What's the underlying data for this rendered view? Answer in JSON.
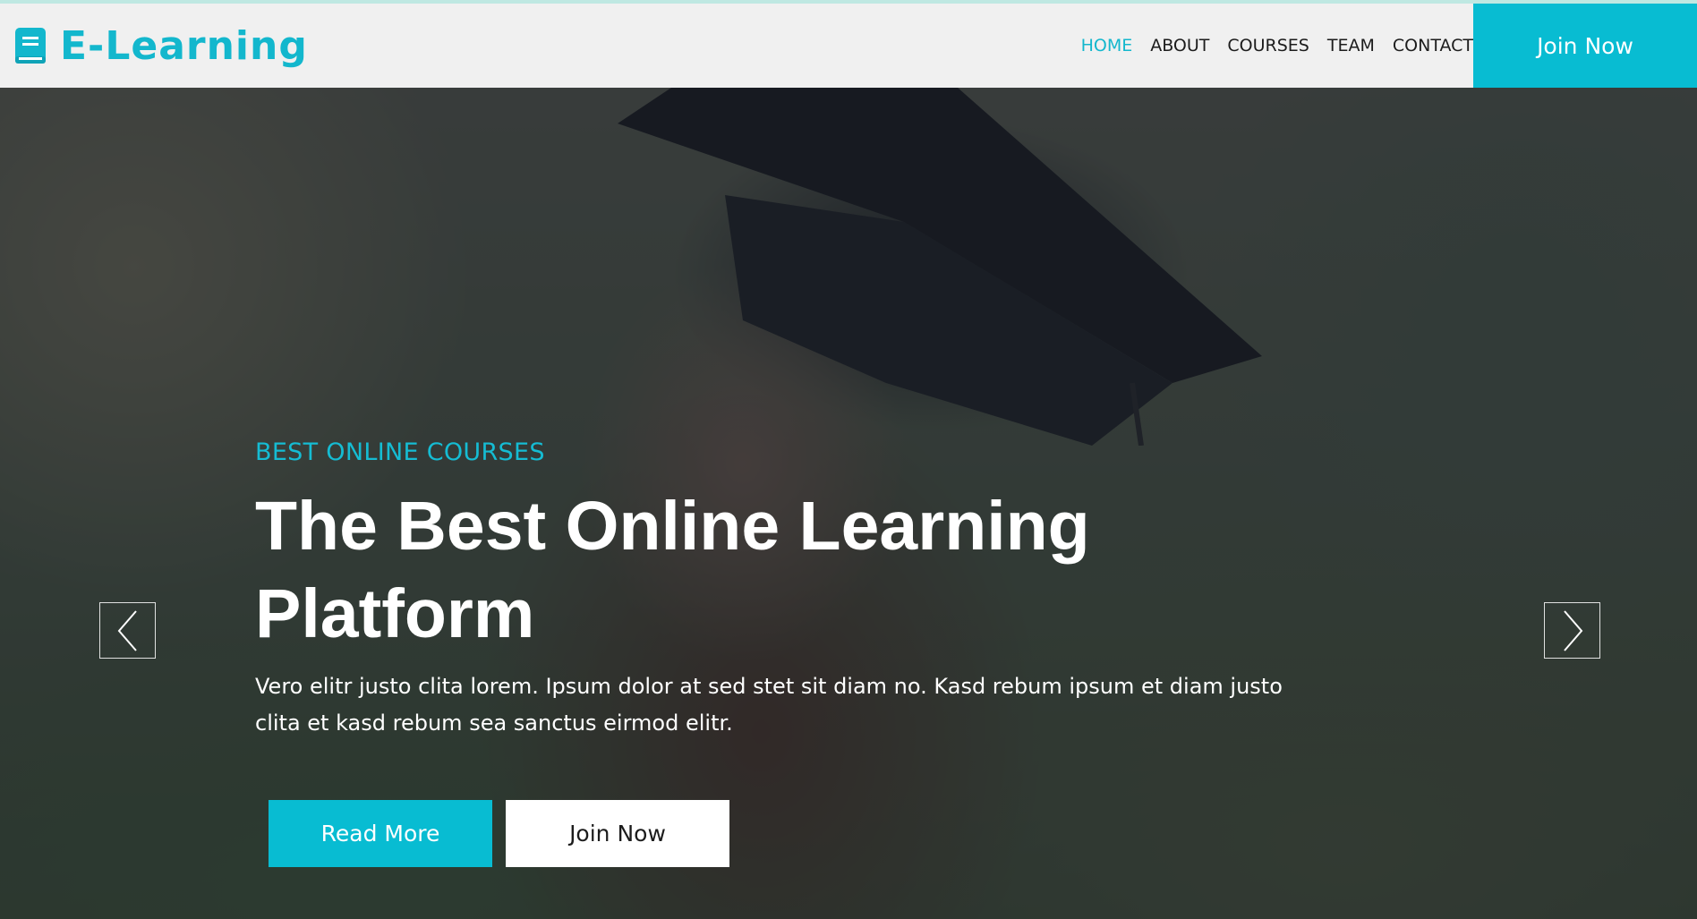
{
  "brand": {
    "name": "E-Learning",
    "icon": "book-icon",
    "accent_color": "#13b7cd"
  },
  "nav": {
    "items": [
      {
        "label": "HOME",
        "active": true
      },
      {
        "label": "ABOUT",
        "active": false
      },
      {
        "label": "COURSES",
        "active": false
      },
      {
        "label": "TEAM",
        "active": false
      },
      {
        "label": "CONTACT",
        "active": false
      }
    ],
    "cta_label": "Join Now",
    "cta_color": "#08bcd2"
  },
  "hero": {
    "kicker": "BEST ONLINE COURSES",
    "title": "The Best Online Learning Platform",
    "text": "Vero elitr justo clita lorem. Ipsum dolor at sed stet sit diam no. Kasd rebum ipsum et diam justo clita et kasd rebum sea sanctus eirmod elitr.",
    "primary_button": "Read More",
    "secondary_button": "Join Now",
    "prev_icon": "chevron-left-icon",
    "next_icon": "chevron-right-icon"
  }
}
